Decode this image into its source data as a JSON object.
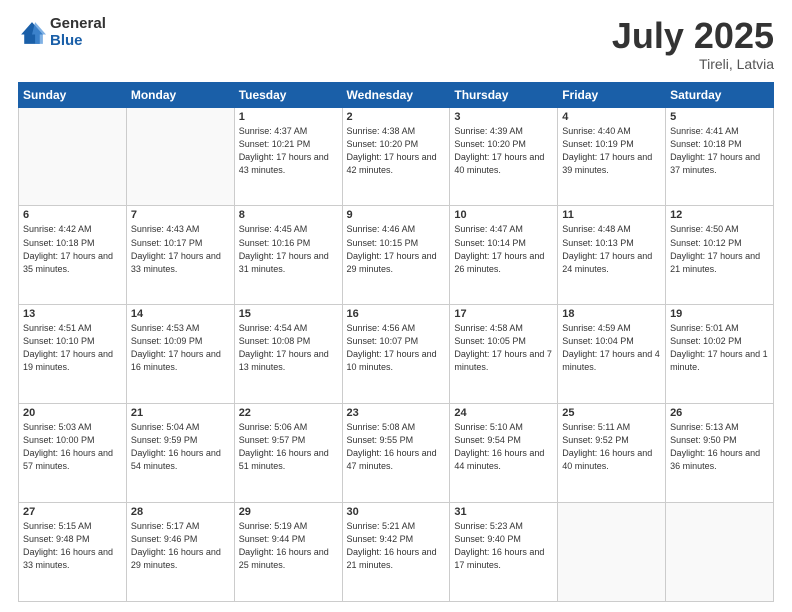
{
  "header": {
    "logo_general": "General",
    "logo_blue": "Blue",
    "title": "July 2025",
    "subtitle": "Tireli, Latvia"
  },
  "weekdays": [
    "Sunday",
    "Monday",
    "Tuesday",
    "Wednesday",
    "Thursday",
    "Friday",
    "Saturday"
  ],
  "rows": [
    [
      {
        "day": "",
        "info": ""
      },
      {
        "day": "",
        "info": ""
      },
      {
        "day": "1",
        "info": "Sunrise: 4:37 AM\nSunset: 10:21 PM\nDaylight: 17 hours\nand 43 minutes."
      },
      {
        "day": "2",
        "info": "Sunrise: 4:38 AM\nSunset: 10:20 PM\nDaylight: 17 hours\nand 42 minutes."
      },
      {
        "day": "3",
        "info": "Sunrise: 4:39 AM\nSunset: 10:20 PM\nDaylight: 17 hours\nand 40 minutes."
      },
      {
        "day": "4",
        "info": "Sunrise: 4:40 AM\nSunset: 10:19 PM\nDaylight: 17 hours\nand 39 minutes."
      },
      {
        "day": "5",
        "info": "Sunrise: 4:41 AM\nSunset: 10:18 PM\nDaylight: 17 hours\nand 37 minutes."
      }
    ],
    [
      {
        "day": "6",
        "info": "Sunrise: 4:42 AM\nSunset: 10:18 PM\nDaylight: 17 hours\nand 35 minutes."
      },
      {
        "day": "7",
        "info": "Sunrise: 4:43 AM\nSunset: 10:17 PM\nDaylight: 17 hours\nand 33 minutes."
      },
      {
        "day": "8",
        "info": "Sunrise: 4:45 AM\nSunset: 10:16 PM\nDaylight: 17 hours\nand 31 minutes."
      },
      {
        "day": "9",
        "info": "Sunrise: 4:46 AM\nSunset: 10:15 PM\nDaylight: 17 hours\nand 29 minutes."
      },
      {
        "day": "10",
        "info": "Sunrise: 4:47 AM\nSunset: 10:14 PM\nDaylight: 17 hours\nand 26 minutes."
      },
      {
        "day": "11",
        "info": "Sunrise: 4:48 AM\nSunset: 10:13 PM\nDaylight: 17 hours\nand 24 minutes."
      },
      {
        "day": "12",
        "info": "Sunrise: 4:50 AM\nSunset: 10:12 PM\nDaylight: 17 hours\nand 21 minutes."
      }
    ],
    [
      {
        "day": "13",
        "info": "Sunrise: 4:51 AM\nSunset: 10:10 PM\nDaylight: 17 hours\nand 19 minutes."
      },
      {
        "day": "14",
        "info": "Sunrise: 4:53 AM\nSunset: 10:09 PM\nDaylight: 17 hours\nand 16 minutes."
      },
      {
        "day": "15",
        "info": "Sunrise: 4:54 AM\nSunset: 10:08 PM\nDaylight: 17 hours\nand 13 minutes."
      },
      {
        "day": "16",
        "info": "Sunrise: 4:56 AM\nSunset: 10:07 PM\nDaylight: 17 hours\nand 10 minutes."
      },
      {
        "day": "17",
        "info": "Sunrise: 4:58 AM\nSunset: 10:05 PM\nDaylight: 17 hours\nand 7 minutes."
      },
      {
        "day": "18",
        "info": "Sunrise: 4:59 AM\nSunset: 10:04 PM\nDaylight: 17 hours\nand 4 minutes."
      },
      {
        "day": "19",
        "info": "Sunrise: 5:01 AM\nSunset: 10:02 PM\nDaylight: 17 hours\nand 1 minute."
      }
    ],
    [
      {
        "day": "20",
        "info": "Sunrise: 5:03 AM\nSunset: 10:00 PM\nDaylight: 16 hours\nand 57 minutes."
      },
      {
        "day": "21",
        "info": "Sunrise: 5:04 AM\nSunset: 9:59 PM\nDaylight: 16 hours\nand 54 minutes."
      },
      {
        "day": "22",
        "info": "Sunrise: 5:06 AM\nSunset: 9:57 PM\nDaylight: 16 hours\nand 51 minutes."
      },
      {
        "day": "23",
        "info": "Sunrise: 5:08 AM\nSunset: 9:55 PM\nDaylight: 16 hours\nand 47 minutes."
      },
      {
        "day": "24",
        "info": "Sunrise: 5:10 AM\nSunset: 9:54 PM\nDaylight: 16 hours\nand 44 minutes."
      },
      {
        "day": "25",
        "info": "Sunrise: 5:11 AM\nSunset: 9:52 PM\nDaylight: 16 hours\nand 40 minutes."
      },
      {
        "day": "26",
        "info": "Sunrise: 5:13 AM\nSunset: 9:50 PM\nDaylight: 16 hours\nand 36 minutes."
      }
    ],
    [
      {
        "day": "27",
        "info": "Sunrise: 5:15 AM\nSunset: 9:48 PM\nDaylight: 16 hours\nand 33 minutes."
      },
      {
        "day": "28",
        "info": "Sunrise: 5:17 AM\nSunset: 9:46 PM\nDaylight: 16 hours\nand 29 minutes."
      },
      {
        "day": "29",
        "info": "Sunrise: 5:19 AM\nSunset: 9:44 PM\nDaylight: 16 hours\nand 25 minutes."
      },
      {
        "day": "30",
        "info": "Sunrise: 5:21 AM\nSunset: 9:42 PM\nDaylight: 16 hours\nand 21 minutes."
      },
      {
        "day": "31",
        "info": "Sunrise: 5:23 AM\nSunset: 9:40 PM\nDaylight: 16 hours\nand 17 minutes."
      },
      {
        "day": "",
        "info": ""
      },
      {
        "day": "",
        "info": ""
      }
    ]
  ]
}
